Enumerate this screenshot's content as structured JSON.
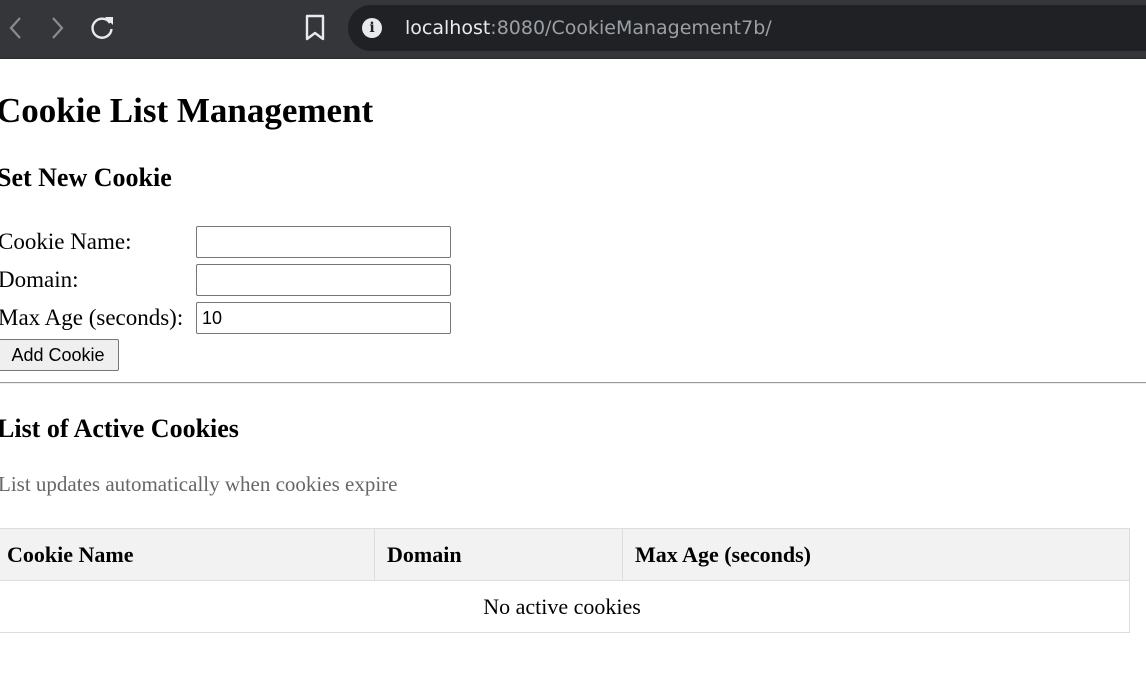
{
  "browser": {
    "url_host": "localhost",
    "url_rest": ":8080/CookieManagement7b/"
  },
  "page": {
    "title": "Cookie List Management",
    "form": {
      "heading": "Set New Cookie",
      "name_label": "Cookie Name:",
      "name_value": "",
      "domain_label": "Domain:",
      "domain_value": "",
      "maxage_label": "Max Age (seconds):",
      "maxage_value": "10",
      "submit_label": "Add Cookie"
    },
    "list": {
      "heading": "List of Active Cookies",
      "note": "List updates automatically when cookies expire",
      "columns": [
        "Cookie Name",
        "Domain",
        "Max Age (seconds)"
      ],
      "empty_message": "No active cookies"
    }
  }
}
